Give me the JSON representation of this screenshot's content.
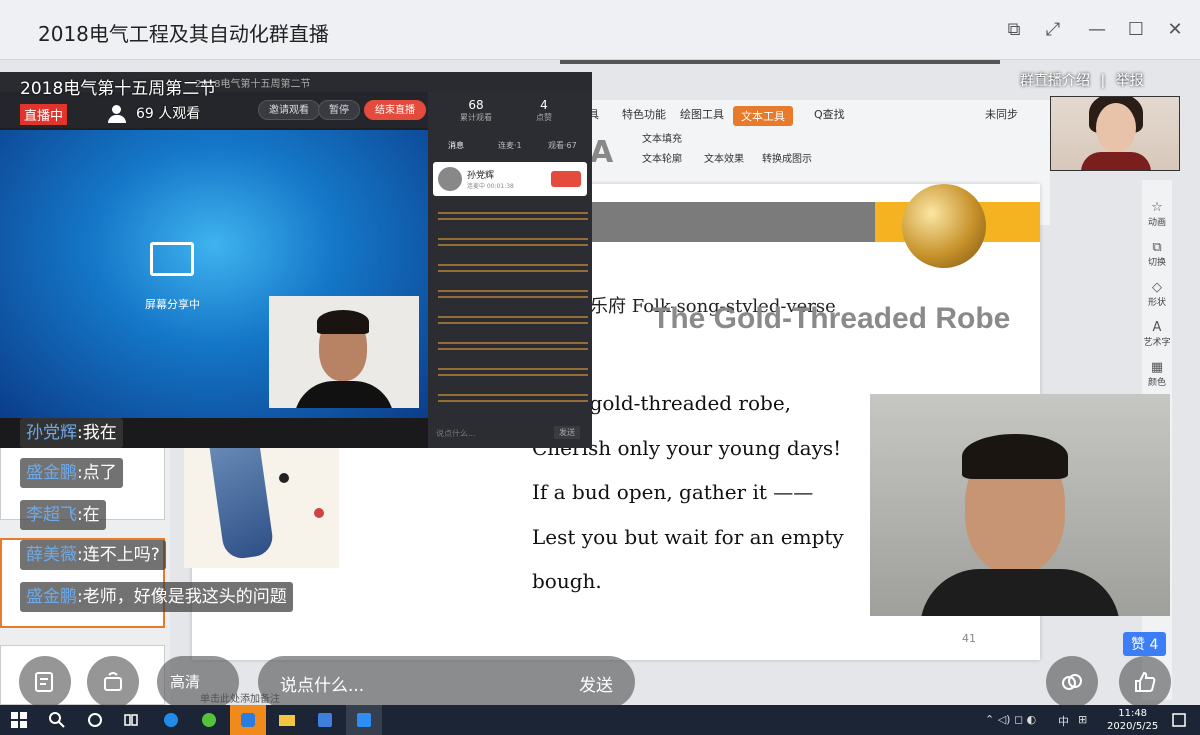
{
  "window": {
    "title": "2018电气工程及其自动化群直播"
  },
  "live": {
    "title": "2018电气第十五周第二节",
    "badge": "直播中",
    "viewers": "69 人观看",
    "group_intro": "群直播介绍",
    "separator": "|",
    "report": "举报"
  },
  "share_panel": {
    "mini_title": "2018电气第十五周第二节",
    "invite": "邀请观看",
    "pause": "暂停",
    "end": "结束直播",
    "sharing_text": "屏幕分享中",
    "stats": [
      {
        "value": "68",
        "label": "累计观看"
      },
      {
        "value": "4",
        "label": "点赞"
      }
    ],
    "tabs": [
      "消息",
      "连麦·1",
      "观看·67"
    ],
    "card_name": "孙党辉",
    "card_sub": "连麦中 00:01:38",
    "input_placeholder": "说点什么...",
    "send": "发送"
  },
  "ribbon": {
    "tabs": [
      "具",
      "特色功能",
      "绘图工具",
      "文本工具",
      "Q查找"
    ],
    "sync": "未同步",
    "items": [
      "文本填充",
      "文本轮廓",
      "文本效果",
      "转换成图示"
    ]
  },
  "right_toolbar": [
    "动画",
    "切换",
    "形状",
    "艺术字",
    "颜色"
  ],
  "slide": {
    "subtitle": "乐府 Folk-song-styled-verse",
    "headline": "The Gold-Threaded Robe",
    "poem": [
      "not a gold-threaded robe,",
      "Cherish only your young days!",
      "If a bud open, gather it ——",
      "Lest you but wait for an empty",
      "bough."
    ],
    "page_number": "41",
    "notes_hint": "单击此处添加备注"
  },
  "chat": [
    {
      "user": "孙党辉",
      "text": ":我在"
    },
    {
      "user": "盛金鹏",
      "text": ":点了"
    },
    {
      "user": "李超飞",
      "text": ":在"
    },
    {
      "user": "薛美薇",
      "text": ":连不上吗?"
    },
    {
      "user": "盛金鹏",
      "text": ":老师，好像是我这头的问题"
    }
  ],
  "controls": {
    "quality": "高清",
    "input_placeholder": "说点什么...",
    "send": "发送",
    "likes": "赞 4"
  },
  "taskbar": {
    "ime": "中",
    "time": "11:48",
    "date": "2020/5/25"
  },
  "colors": {
    "live_red": "#e0342d",
    "chat_name_blue": "#6ea9e8",
    "accent_orange": "#e87a2c",
    "like_blue": "#3b7ef5",
    "slide_yellow": "#f5b321"
  }
}
